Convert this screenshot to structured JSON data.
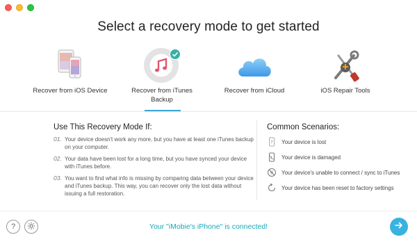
{
  "window": {
    "controls": [
      "close",
      "minimize",
      "zoom"
    ]
  },
  "heading": "Select a recovery mode to get started",
  "modes": [
    {
      "label": "Recover from iOS Device",
      "icon": "ios-devices-icon",
      "selected": false
    },
    {
      "label": "Recover from iTunes Backup",
      "icon": "itunes-icon",
      "selected": true
    },
    {
      "label": "Recover from iCloud",
      "icon": "icloud-icon",
      "selected": false
    },
    {
      "label": "iOS Repair Tools",
      "icon": "repair-tools-icon",
      "selected": false
    }
  ],
  "usage": {
    "title": "Use This Recovery Mode If:",
    "items": [
      {
        "num": "01.",
        "text": "Your device doesn't work any more, but you have at least one iTunes backup on your computer."
      },
      {
        "num": "02.",
        "text": "Your data have been lost for a long time, but you have synced your device with iTunes before."
      },
      {
        "num": "03.",
        "text": "You want to find what info is missing by comparing data between your device and iTunes backup. This way, you can recover only the lost data without issuing a full restoration."
      }
    ]
  },
  "scenarios": {
    "title": "Common Scenarios:",
    "items": [
      {
        "text": "Your device is lost",
        "icon": "lost-device-icon"
      },
      {
        "text": "Your device is damaged",
        "icon": "damaged-device-icon"
      },
      {
        "text": "Your device's unable to connect / sync to iTunes",
        "icon": "no-connect-icon"
      },
      {
        "text": "Your device has been reset to factory settings",
        "icon": "reset-icon"
      }
    ]
  },
  "footer": {
    "help_symbol": "?",
    "status": "Your \"iMobie's iPhone\" is connected!",
    "accent": "#39b2e0"
  }
}
